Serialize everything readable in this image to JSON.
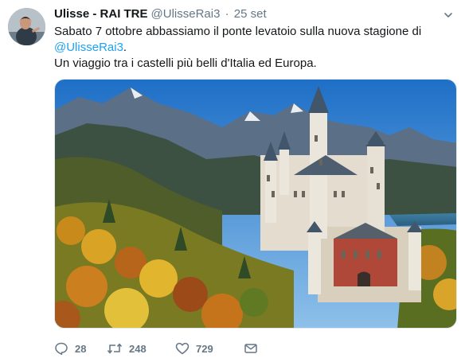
{
  "tweet": {
    "author_name": "Ulisse - RAI TRE",
    "author_handle": "@UlisseRai3",
    "separator": "·",
    "timestamp": "25 set",
    "text_line1": "Sabato 7 ottobre abbassiamo il ponte levatoio sulla nuova stagione di",
    "mention": "@UlisseRai3",
    "mention_suffix": ".",
    "text_line3": "Un viaggio tra i castelli più belli d'Italia ed Europa.",
    "media_icon": "castle-photo"
  },
  "actions": {
    "reply_icon": "reply-icon",
    "reply_count": "28",
    "retweet_icon": "retweet-icon",
    "retweet_count": "248",
    "like_icon": "heart-icon",
    "like_count": "729",
    "dm_icon": "envelope-icon"
  },
  "colors": {
    "text": "#14171a",
    "secondary": "#657786",
    "link": "#1da1f2"
  }
}
